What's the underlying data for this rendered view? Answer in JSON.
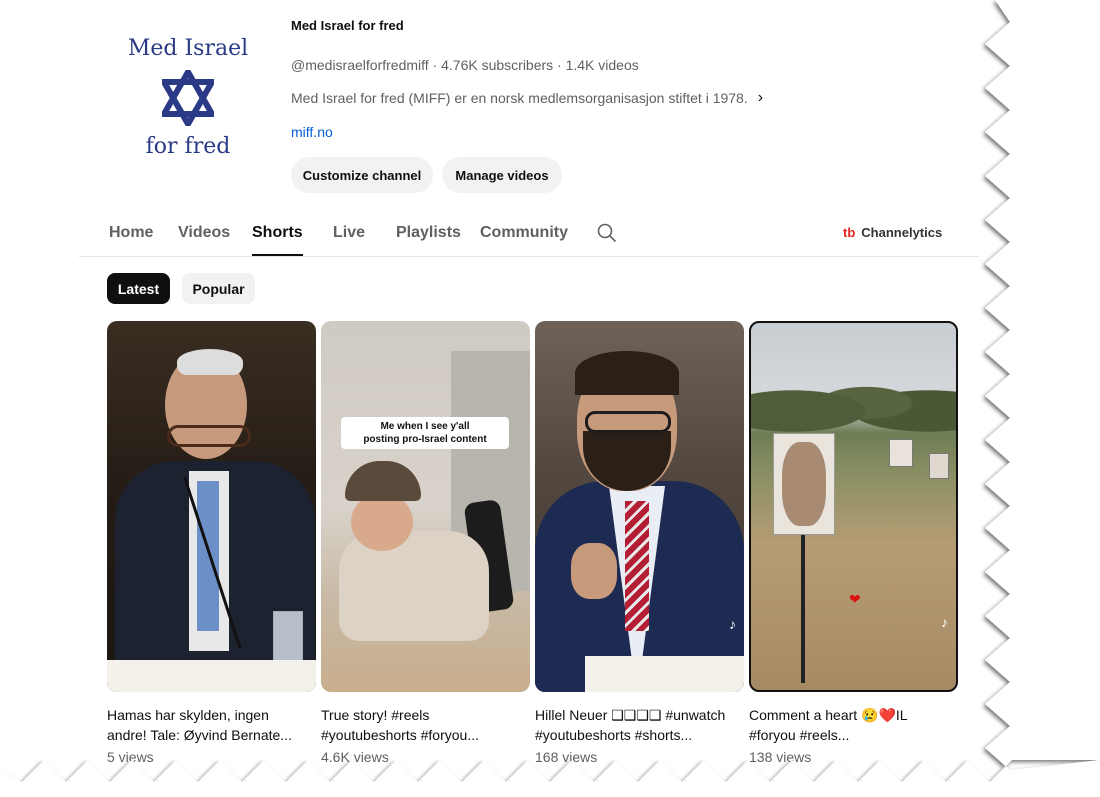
{
  "channel": {
    "logo_line1": "Med Israel",
    "logo_line2": "for fred",
    "name": "Med Israel for fred",
    "meta": "@medisraelforfredmiff · 4.76K subscribers · 1.4K videos",
    "description": "Med Israel for fred (MIFF) er en norsk medlemsorganisasjon stiftet i 1978.",
    "description_more_icon": "chevron-right-icon",
    "link": "miff.no",
    "customize_label": "Customize channel",
    "manage_label": "Manage videos"
  },
  "tabs": [
    {
      "label": "Home"
    },
    {
      "label": "Videos"
    },
    {
      "label": "Shorts"
    },
    {
      "label": "Live"
    },
    {
      "label": "Playlists"
    },
    {
      "label": "Community"
    }
  ],
  "active_tab": "Shorts",
  "extension": {
    "icon": "tb",
    "label": "Channelytics"
  },
  "chips": {
    "latest": "Latest",
    "popular": "Popular"
  },
  "shorts": [
    {
      "title_line1": "Hamas har skylden, ingen",
      "title_line2": "andre! Tale: Øyvind Bernate...",
      "views": "5 views"
    },
    {
      "title_line1": "True story! #reels",
      "title_line2": "#youtubeshorts #foryou...",
      "views": "4.6K views",
      "overlay_text_line1": "Me when I see y'all",
      "overlay_text_line2": "posting pro-Israel content"
    },
    {
      "title_line1": "Hillel Neuer ❑❑❑❑ #unwatch",
      "title_line2": "#youtubeshorts #shorts...",
      "views": "168 views"
    },
    {
      "title_line1": "Comment a heart 😢❤️IL",
      "title_line2": "#foryou #reels...",
      "views": "138 views"
    }
  ],
  "colors": {
    "accent_link": "#065fd4",
    "logo_blue": "#2b3a86",
    "channelytics_red": "#e2231a"
  }
}
